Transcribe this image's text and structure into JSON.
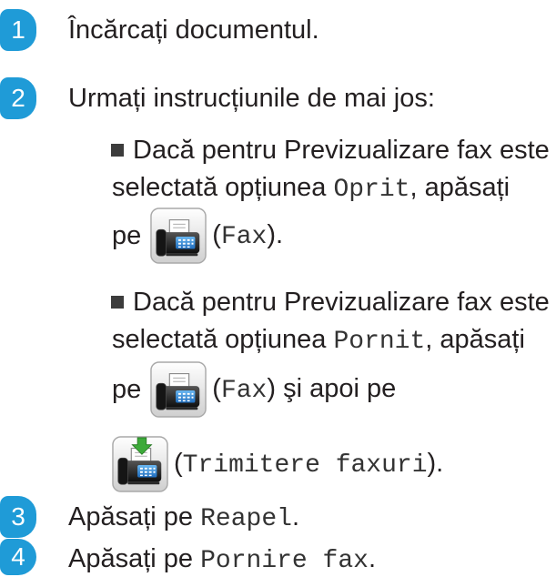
{
  "colors": {
    "accent": "#1f9bd7",
    "text": "#231f20",
    "bullet": "#3c3c3c",
    "code": "#333333",
    "arrow": "#3daa3a"
  },
  "icons": {
    "fax": "fax-icon",
    "fax_send": "fax-send-icon"
  },
  "steps": [
    {
      "number": "1",
      "text": "Încărcați documentul."
    },
    {
      "number": "2",
      "text": "Urmați instrucțiunile de mai jos:",
      "bullets": [
        {
          "line1": "Dacă pentru Previzualizare fax este",
          "line2_pre": "selectată opțiunea ",
          "line2_code": "Oprit",
          "line2_post": ", apăsați",
          "line3_pre": "pe",
          "line3_open": "(",
          "line3_code": "Fax",
          "line3_post": ")."
        },
        {
          "line1": "Dacă pentru Previzualizare fax este",
          "line2_pre": "selectată opțiunea ",
          "line2_code": "Pornit",
          "line2_post": ", apăsați",
          "line3_pre": "pe",
          "line3_open": "(",
          "line3_code": "Fax",
          "line3_post": ") şi apoi pe",
          "line4_open": "(",
          "line4_code": "Trimitere faxuri",
          "line4_post": ")."
        }
      ]
    },
    {
      "number": "3",
      "pre": "Apăsați pe ",
      "code": "Reapel",
      "post": "."
    },
    {
      "number": "4",
      "pre": "Apăsați pe ",
      "code": "Pornire fax",
      "post": "."
    }
  ]
}
